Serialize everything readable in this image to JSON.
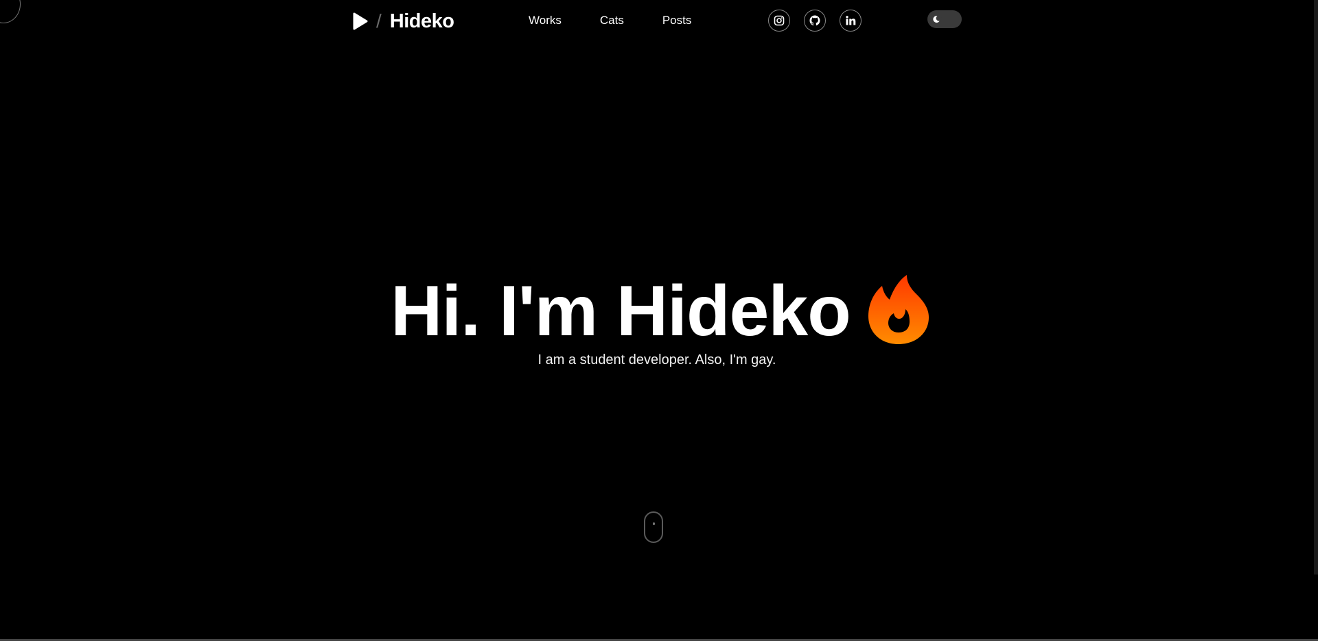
{
  "header": {
    "logo": {
      "separator": "/",
      "name": "Hideko",
      "icon": "play-icon"
    },
    "nav": [
      {
        "label": "Works"
      },
      {
        "label": "Cats"
      },
      {
        "label": "Posts"
      }
    ],
    "socials": [
      {
        "icon": "instagram-icon"
      },
      {
        "icon": "github-icon"
      },
      {
        "icon": "linkedin-icon"
      }
    ],
    "theme_toggle": {
      "icon": "moon-icon",
      "mode": "dark"
    }
  },
  "hero": {
    "title": "Hi. I'm Hideko",
    "subtitle": "I am a student developer. Also, I'm gay.",
    "emoji_icon": "flame-icon"
  },
  "scroll_indicator": {
    "icon": "mouse-scroll-icon"
  },
  "colors": {
    "background": "#000000",
    "text": "#ffffff",
    "flame_top": "#ff3c00",
    "flame_bottom": "#ff8a00"
  }
}
